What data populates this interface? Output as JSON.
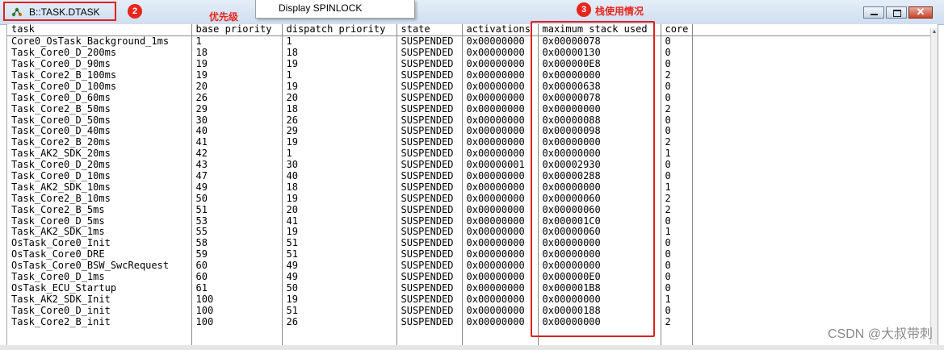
{
  "window": {
    "title": "B::TASK.DTASK",
    "minimize_label": "minimize",
    "maximize_label": "maximize",
    "close_glyph": "✕"
  },
  "menu_popup": {
    "label": "Display SPINLOCK"
  },
  "annotations": {
    "badge2": "2",
    "badge3": "3",
    "priority_note": "优先级",
    "stack_note": "栈使用情况"
  },
  "table": {
    "columns": [
      "task",
      "base priority",
      "dispatch priority",
      "state",
      "activations",
      "maximum stack used",
      "core"
    ],
    "rows": [
      [
        "Core0_OsTask_Background_1ms",
        "1",
        "1",
        "SUSPENDED",
        "0x00000000",
        "0x00000078",
        "0"
      ],
      [
        "Task_Core0_D_200ms",
        "18",
        "18",
        "SUSPENDED",
        "0x00000000",
        "0x00000130",
        "0"
      ],
      [
        "Task_Core0_D_90ms",
        "19",
        "19",
        "SUSPENDED",
        "0x00000000",
        "0x000000E8",
        "0"
      ],
      [
        "Task_Core2_B_100ms",
        "19",
        "1",
        "SUSPENDED",
        "0x00000000",
        "0x00000000",
        "2"
      ],
      [
        "Task_Core0_D_100ms",
        "20",
        "19",
        "SUSPENDED",
        "0x00000000",
        "0x00000638",
        "0"
      ],
      [
        "Task_Core0_D_60ms",
        "26",
        "20",
        "SUSPENDED",
        "0x00000000",
        "0x00000078",
        "0"
      ],
      [
        "Task_Core2_B_50ms",
        "29",
        "18",
        "SUSPENDED",
        "0x00000000",
        "0x00000000",
        "2"
      ],
      [
        "Task_Core0_D_50ms",
        "30",
        "26",
        "SUSPENDED",
        "0x00000000",
        "0x00000088",
        "0"
      ],
      [
        "Task_Core0_D_40ms",
        "40",
        "29",
        "SUSPENDED",
        "0x00000000",
        "0x00000098",
        "0"
      ],
      [
        "Task_Core2_B_20ms",
        "41",
        "19",
        "SUSPENDED",
        "0x00000000",
        "0x00000000",
        "2"
      ],
      [
        "Task_AK2_SDK_20ms",
        "42",
        "1",
        "SUSPENDED",
        "0x00000000",
        "0x00000000",
        "1"
      ],
      [
        "Task_Core0_D_20ms",
        "43",
        "30",
        "SUSPENDED",
        "0x00000001",
        "0x00002930",
        "0"
      ],
      [
        "Task_Core0_D_10ms",
        "47",
        "40",
        "SUSPENDED",
        "0x00000000",
        "0x00000288",
        "0"
      ],
      [
        "Task_AK2_SDK_10ms",
        "49",
        "18",
        "SUSPENDED",
        "0x00000000",
        "0x00000000",
        "1"
      ],
      [
        "Task_Core2_B_10ms",
        "50",
        "19",
        "SUSPENDED",
        "0x00000000",
        "0x00000060",
        "2"
      ],
      [
        "Task_Core2_B_5ms",
        "51",
        "20",
        "SUSPENDED",
        "0x00000000",
        "0x00000060",
        "2"
      ],
      [
        "Task_Core0_D_5ms",
        "53",
        "41",
        "SUSPENDED",
        "0x00000000",
        "0x000001C0",
        "0"
      ],
      [
        "Task_AK2_SDK_1ms",
        "55",
        "19",
        "SUSPENDED",
        "0x00000000",
        "0x00000060",
        "1"
      ],
      [
        "OsTask_Core0_Init",
        "58",
        "51",
        "SUSPENDED",
        "0x00000000",
        "0x00000000",
        "0"
      ],
      [
        "OsTask_Core0_DRE",
        "59",
        "51",
        "SUSPENDED",
        "0x00000000",
        "0x00000000",
        "0"
      ],
      [
        "OsTask_Core0_BSW_SwcRequest",
        "60",
        "49",
        "SUSPENDED",
        "0x00000000",
        "0x00000000",
        "0"
      ],
      [
        "Task_Core0_D_1ms",
        "60",
        "49",
        "SUSPENDED",
        "0x00000000",
        "0x000000E0",
        "0"
      ],
      [
        "OsTask_ECU_Startup",
        "61",
        "50",
        "SUSPENDED",
        "0x00000000",
        "0x000001B8",
        "0"
      ],
      [
        "Task_AK2_SDK_Init",
        "100",
        "19",
        "SUSPENDED",
        "0x00000000",
        "0x00000000",
        "1"
      ],
      [
        "Task_Core0_D_init",
        "100",
        "51",
        "SUSPENDED",
        "0x00000000",
        "0x00000188",
        "0"
      ],
      [
        "Task_Core2_B_init",
        "100",
        "26",
        "SUSPENDED",
        "0x00000000",
        "0x00000000",
        "2"
      ]
    ]
  },
  "watermark": "CSDN @大叔带刺",
  "colors": {
    "annotation_red": "#e8251c",
    "titlebar_top": "#e4eef9",
    "titlebar_bottom": "#cfdeef"
  }
}
